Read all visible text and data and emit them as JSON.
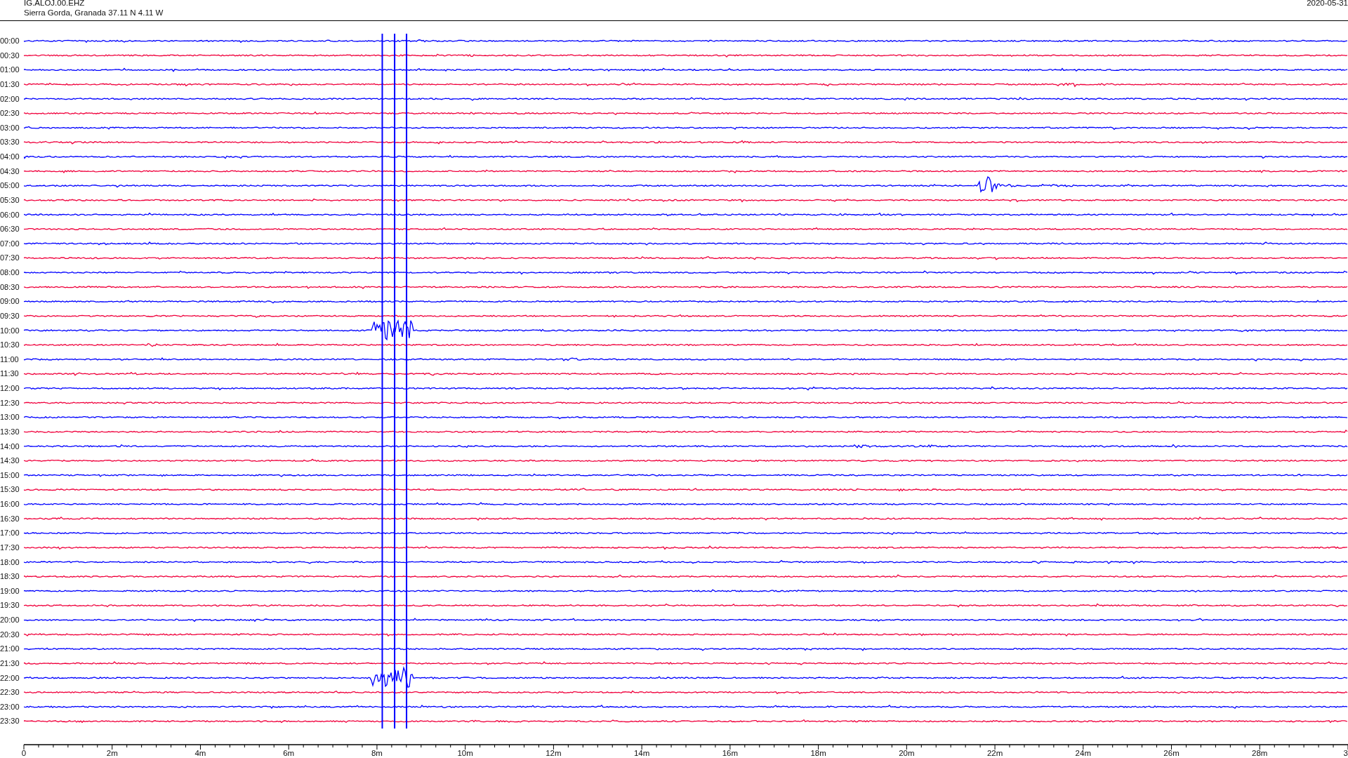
{
  "header": {
    "station": "IG.ALOJ.00.EHZ",
    "location": "Sierra Gorda, Granada  37.11 N 4.11 W",
    "date": "2020-05-31"
  },
  "rows": [
    {
      "time": "00:00",
      "color": "#0000ff"
    },
    {
      "time": "00:30",
      "color": "#f0003c"
    },
    {
      "time": "01:00",
      "color": "#0000ff"
    },
    {
      "time": "01:30",
      "color": "#f0003c"
    },
    {
      "time": "02:00",
      "color": "#0000ff"
    },
    {
      "time": "02:30",
      "color": "#f0003c"
    },
    {
      "time": "03:00",
      "color": "#0000ff"
    },
    {
      "time": "03:30",
      "color": "#f0003c"
    },
    {
      "time": "04:00",
      "color": "#0000ff"
    },
    {
      "time": "04:30",
      "color": "#f0003c"
    },
    {
      "time": "05:00",
      "color": "#0000ff"
    },
    {
      "time": "05:30",
      "color": "#f0003c"
    },
    {
      "time": "06:00",
      "color": "#0000ff"
    },
    {
      "time": "06:30",
      "color": "#f0003c"
    },
    {
      "time": "07:00",
      "color": "#0000ff"
    },
    {
      "time": "07:30",
      "color": "#f0003c"
    },
    {
      "time": "08:00",
      "color": "#0000ff"
    },
    {
      "time": "08:30",
      "color": "#f0003c"
    },
    {
      "time": "09:00",
      "color": "#0000ff"
    },
    {
      "time": "09:30",
      "color": "#f0003c"
    },
    {
      "time": "10:00",
      "color": "#0000ff"
    },
    {
      "time": "10:30",
      "color": "#f0003c"
    },
    {
      "time": "11:00",
      "color": "#0000ff"
    },
    {
      "time": "11:30",
      "color": "#f0003c"
    },
    {
      "time": "12:00",
      "color": "#0000ff"
    },
    {
      "time": "12:30",
      "color": "#f0003c"
    },
    {
      "time": "13:00",
      "color": "#0000ff"
    },
    {
      "time": "13:30",
      "color": "#f0003c"
    },
    {
      "time": "14:00",
      "color": "#0000ff"
    },
    {
      "time": "14:30",
      "color": "#f0003c"
    },
    {
      "time": "15:00",
      "color": "#0000ff"
    },
    {
      "time": "15:30",
      "color": "#f0003c"
    },
    {
      "time": "16:00",
      "color": "#0000ff"
    },
    {
      "time": "16:30",
      "color": "#f0003c"
    },
    {
      "time": "17:00",
      "color": "#0000ff"
    },
    {
      "time": "17:30",
      "color": "#f0003c"
    },
    {
      "time": "18:00",
      "color": "#0000ff"
    },
    {
      "time": "18:30",
      "color": "#f0003c"
    },
    {
      "time": "19:00",
      "color": "#0000ff"
    },
    {
      "time": "19:30",
      "color": "#f0003c"
    },
    {
      "time": "20:00",
      "color": "#0000ff"
    },
    {
      "time": "20:30",
      "color": "#f0003c"
    },
    {
      "time": "21:00",
      "color": "#0000ff"
    },
    {
      "time": "21:30",
      "color": "#f0003c"
    },
    {
      "time": "22:00",
      "color": "#0000ff"
    },
    {
      "time": "22:30",
      "color": "#f0003c"
    },
    {
      "time": "23:00",
      "color": "#0000ff"
    },
    {
      "time": "23:30",
      "color": "#f0003c"
    }
  ],
  "axis": {
    "ticks": [
      "0",
      "2m",
      "4m",
      "6m",
      "8m",
      "10m",
      "12m",
      "14m",
      "16m",
      "18m",
      "20m",
      "22m",
      "24m",
      "26m",
      "28m",
      "3"
    ]
  }
}
